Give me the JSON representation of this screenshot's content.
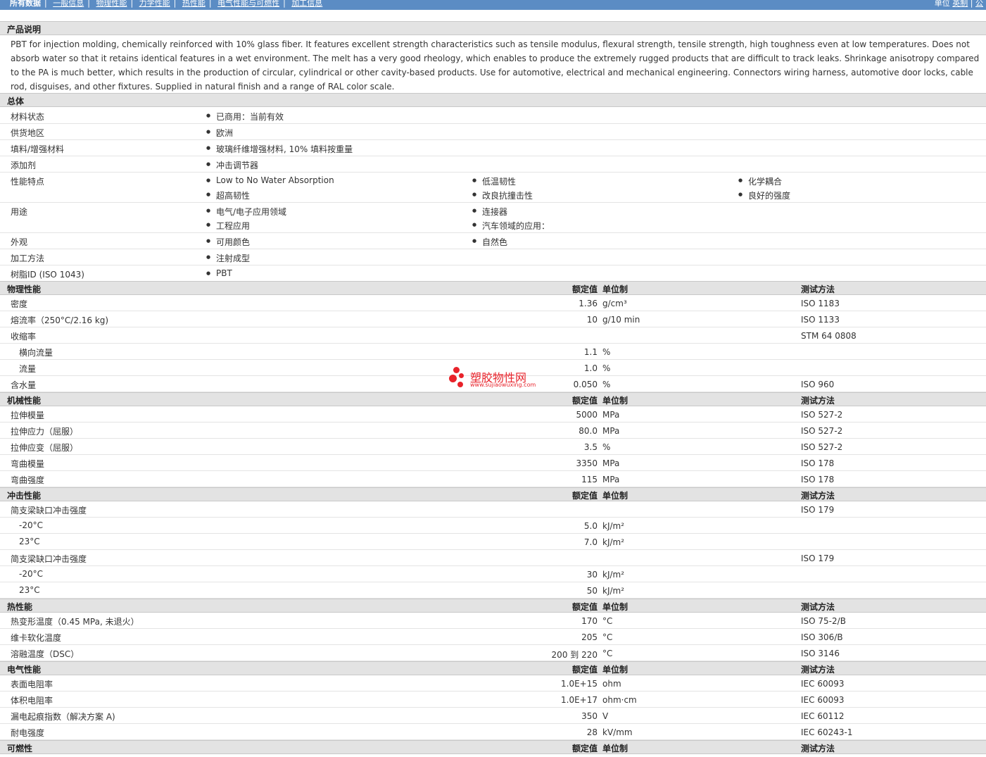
{
  "nav": {
    "tabs": [
      "所有数据",
      "一般信息",
      "物理性能",
      "力学性能",
      "热性能",
      "电气性能与可燃性",
      "加工信息"
    ],
    "right_label": "单位",
    "right_links": [
      "英制",
      "公"
    ]
  },
  "description": {
    "title": "产品说明",
    "text": "PBT for injection molding, chemically reinforced with 10% glass fiber. It features excellent strength characteristics such as tensile modulus, flexural strength, tensile strength, high toughness even at low temperatures. Does not absorb water so that it retains identical features in a wet environment. The melt has a very good rheology, which enables to produce the extremely rugged products that are difficult to track leaks. Shrinkage anisotropy compared to the PA is much better, which results in the production of circular, cylindrical or other cavity-based products. Use for automotive, electrical and mechanical engineering. Connectors wiring harness, automotive door locks, cable rod, disguises, and other fixtures. Supplied in natural finish and a range of RAL color scale."
  },
  "general": {
    "title": "总体",
    "rows": [
      {
        "label": "材料状态",
        "items": [
          [
            "已商用：当前有效"
          ]
        ]
      },
      {
        "label": "供货地区",
        "items": [
          [
            "欧洲"
          ]
        ]
      },
      {
        "label": "填料/增强材料",
        "items": [
          [
            "玻璃纤维增强材料, 10% 填料按重量"
          ]
        ]
      },
      {
        "label": "添加剂",
        "items": [
          [
            "冲击调节器"
          ]
        ]
      },
      {
        "label": "性能特点",
        "items": [
          [
            "Low to No Water Absorption",
            "超高韧性"
          ],
          [
            "低温韧性",
            "改良抗撞击性"
          ],
          [
            "化学耦合",
            "良好的强度"
          ]
        ]
      },
      {
        "label": "用途",
        "items": [
          [
            "电气/电子应用领域",
            "工程应用"
          ],
          [
            "连接器",
            "汽车领域的应用："
          ]
        ]
      },
      {
        "label": "外观",
        "items": [
          [
            "可用颜色"
          ],
          [
            "自然色"
          ]
        ]
      },
      {
        "label": "加工方法",
        "items": [
          [
            "注射成型"
          ]
        ]
      },
      {
        "label": "树脂ID (ISO 1043)",
        "items": [
          [
            "PBT"
          ]
        ]
      }
    ]
  },
  "headers": {
    "value": "额定值",
    "unit": "单位制",
    "method": "测试方法"
  },
  "physical": {
    "title": "物理性能",
    "rows": [
      {
        "label": "密度",
        "value": "1.36",
        "unit": "g/cm³",
        "method": "ISO 1183"
      },
      {
        "label": "熔流率（250°C/2.16 kg)",
        "value": "10",
        "unit": "g/10 min",
        "method": "ISO 1133"
      },
      {
        "label": "收缩率",
        "value": "",
        "unit": "",
        "method": "STM 64 0808"
      },
      {
        "label": "横向流量",
        "value": "1.1",
        "unit": "%",
        "method": "",
        "indent": true
      },
      {
        "label": "流量",
        "value": "1.0",
        "unit": "%",
        "method": "",
        "indent": true
      },
      {
        "label": "含水量",
        "value": "0.050",
        "unit": "%",
        "method": "ISO 960"
      }
    ]
  },
  "mechanical": {
    "title": "机械性能",
    "rows": [
      {
        "label": "拉伸模量",
        "value": "5000",
        "unit": "MPa",
        "method": "ISO 527-2"
      },
      {
        "label": "拉伸应力（屈服）",
        "value": "80.0",
        "unit": "MPa",
        "method": "ISO 527-2"
      },
      {
        "label": "拉伸应变（屈服）",
        "value": "3.5",
        "unit": "%",
        "method": "ISO 527-2"
      },
      {
        "label": "弯曲模量",
        "value": "3350",
        "unit": "MPa",
        "method": "ISO 178"
      },
      {
        "label": "弯曲强度",
        "value": "115",
        "unit": "MPa",
        "method": "ISO 178"
      }
    ]
  },
  "impact": {
    "title": "冲击性能",
    "rows": [
      {
        "label": "简支梁缺口冲击强度",
        "value": "",
        "unit": "",
        "method": "ISO 179"
      },
      {
        "label": "-20°C",
        "value": "5.0",
        "unit": "kJ/m²",
        "method": "",
        "indent": true
      },
      {
        "label": "23°C",
        "value": "7.0",
        "unit": "kJ/m²",
        "method": "",
        "indent": true
      },
      {
        "label": "简支梁缺口冲击强度",
        "value": "",
        "unit": "",
        "method": "ISO 179"
      },
      {
        "label": "-20°C",
        "value": "30",
        "unit": "kJ/m²",
        "method": "",
        "indent": true
      },
      {
        "label": "23°C",
        "value": "50",
        "unit": "kJ/m²",
        "method": "",
        "indent": true
      }
    ]
  },
  "thermal": {
    "title": "热性能",
    "rows": [
      {
        "label": "热变形温度（0.45 MPa, 未退火）",
        "value": "170",
        "unit": "°C",
        "method": "ISO 75-2/B"
      },
      {
        "label": "维卡软化温度",
        "value": "205",
        "unit": "°C",
        "method": "ISO 306/B"
      },
      {
        "label": "溶融温度（DSC）",
        "value": "200 到  220",
        "unit": "°C",
        "method": "ISO 3146"
      }
    ]
  },
  "electrical": {
    "title": "电气性能",
    "rows": [
      {
        "label": "表面电阻率",
        "value": "1.0E+15",
        "unit": "ohm",
        "method": "IEC 60093"
      },
      {
        "label": "体积电阻率",
        "value": "1.0E+17",
        "unit": "ohm·cm",
        "method": "IEC 60093"
      },
      {
        "label": "漏电起痕指数（解决方案 A)",
        "value": "350",
        "unit": "V",
        "method": "IEC 60112"
      },
      {
        "label": "耐电强度",
        "value": "28",
        "unit": "kV/mm",
        "method": "IEC 60243-1"
      }
    ]
  },
  "flammability": {
    "title": "可燃性"
  },
  "watermark": {
    "cn": "塑胶物性网",
    "en": "www.sujiaowuxing.com"
  },
  "colors": {
    "nav_bg": "#5b8cc4",
    "section_bg": "#e3e3e3",
    "watermark": "#e8222a"
  }
}
